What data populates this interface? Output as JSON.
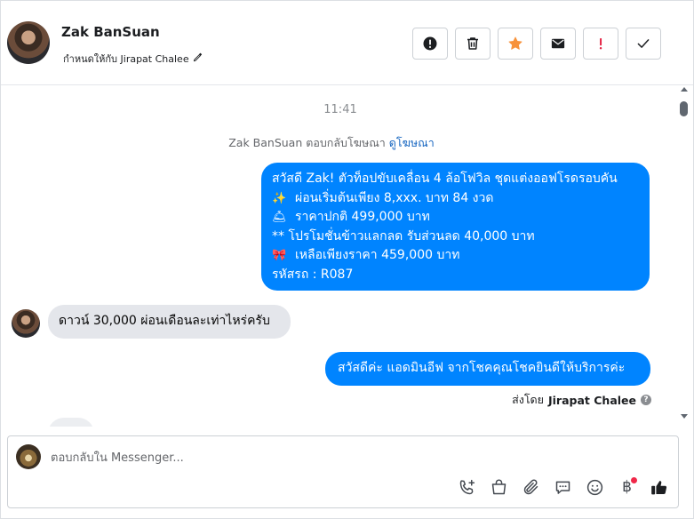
{
  "header": {
    "contact_name": "Zak BanSuan",
    "assigned_label": "กำหนดให้กับ Jirapat Chalee"
  },
  "header_actions": [
    {
      "name": "spam-button",
      "icon": "alert-circle-icon",
      "color": "#1c1e21"
    },
    {
      "name": "delete-button",
      "icon": "trash-icon",
      "color": "#1c1e21"
    },
    {
      "name": "star-button",
      "icon": "star-icon",
      "color": "#f7923b"
    },
    {
      "name": "mark-unread-button",
      "icon": "envelope-icon",
      "color": "#1c1e21"
    },
    {
      "name": "follow-up-button",
      "icon": "exclamation-icon",
      "color": "#e41e3f"
    },
    {
      "name": "done-button",
      "icon": "check-icon",
      "color": "#1c1e21"
    }
  ],
  "thread": {
    "timestamp": "11:41",
    "reply_note_prefix": "Zak BanSuan ตอบกลับโฆษณา",
    "reply_note_link": "ดูโฆษณา",
    "outgoing_ad_message": [
      {
        "emoji": "",
        "text": "สวัสดี Zak! ตัวท็อปขับเคลื่อน 4 ล้อโฟวิล ชุดแต่งออฟโรดรอบคัน"
      },
      {
        "emoji": "✨",
        "text": "ผ่อนเริ่มต้นเพียง 8,xxx. บาท 84 งวด"
      },
      {
        "emoji": "🛎",
        "text": "ราคาปกติ 499,000 บาท"
      },
      {
        "emoji": "",
        "text": "** โปรโมชั่นข้าวแลกลด รับส่วนลด 40,000 บาท"
      },
      {
        "emoji": "🎀",
        "text": "เหลือเพียงราคา 459,000 บาท"
      },
      {
        "emoji": "",
        "text": " รหัสรถ : R087"
      }
    ],
    "incoming_message": "ดาวน์ 30,000 ผ่อนเดือนละเท่าไหร่ครับ",
    "outgoing_reply": "สวัสดีค่ะ แอดมินอีฟ จากโชคคุณโชคยินดีให้บริการค่ะ",
    "sent_by_prefix": "ส่งโดย",
    "sent_by_name": "Jirapat Chalee"
  },
  "composer": {
    "placeholder": "ตอบกลับใน Messenger...",
    "tools": [
      "call-add-icon",
      "shopping-bag-icon",
      "paperclip-icon",
      "chat-bubble-icon",
      "emoji-smile-icon",
      "baht-icon",
      "thumbs-up-icon"
    ],
    "baht_symbol": "฿"
  },
  "colors": {
    "outgoing_bubble": "#0084ff",
    "incoming_bubble": "#e4e6eb",
    "link": "#1565c0",
    "notification_dot": "#f02849"
  }
}
